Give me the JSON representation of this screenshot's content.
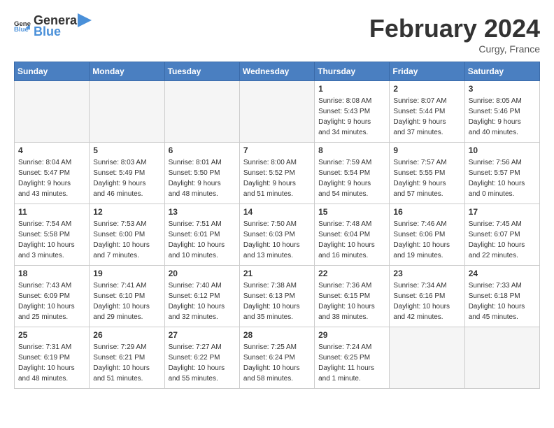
{
  "header": {
    "logo_general": "General",
    "logo_blue": "Blue",
    "month_year": "February 2024",
    "location": "Curgy, France"
  },
  "days_of_week": [
    "Sunday",
    "Monday",
    "Tuesday",
    "Wednesday",
    "Thursday",
    "Friday",
    "Saturday"
  ],
  "weeks": [
    [
      {
        "day": "",
        "info": ""
      },
      {
        "day": "",
        "info": ""
      },
      {
        "day": "",
        "info": ""
      },
      {
        "day": "",
        "info": ""
      },
      {
        "day": "1",
        "info": "Sunrise: 8:08 AM\nSunset: 5:43 PM\nDaylight: 9 hours\nand 34 minutes."
      },
      {
        "day": "2",
        "info": "Sunrise: 8:07 AM\nSunset: 5:44 PM\nDaylight: 9 hours\nand 37 minutes."
      },
      {
        "day": "3",
        "info": "Sunrise: 8:05 AM\nSunset: 5:46 PM\nDaylight: 9 hours\nand 40 minutes."
      }
    ],
    [
      {
        "day": "4",
        "info": "Sunrise: 8:04 AM\nSunset: 5:47 PM\nDaylight: 9 hours\nand 43 minutes."
      },
      {
        "day": "5",
        "info": "Sunrise: 8:03 AM\nSunset: 5:49 PM\nDaylight: 9 hours\nand 46 minutes."
      },
      {
        "day": "6",
        "info": "Sunrise: 8:01 AM\nSunset: 5:50 PM\nDaylight: 9 hours\nand 48 minutes."
      },
      {
        "day": "7",
        "info": "Sunrise: 8:00 AM\nSunset: 5:52 PM\nDaylight: 9 hours\nand 51 minutes."
      },
      {
        "day": "8",
        "info": "Sunrise: 7:59 AM\nSunset: 5:54 PM\nDaylight: 9 hours\nand 54 minutes."
      },
      {
        "day": "9",
        "info": "Sunrise: 7:57 AM\nSunset: 5:55 PM\nDaylight: 9 hours\nand 57 minutes."
      },
      {
        "day": "10",
        "info": "Sunrise: 7:56 AM\nSunset: 5:57 PM\nDaylight: 10 hours\nand 0 minutes."
      }
    ],
    [
      {
        "day": "11",
        "info": "Sunrise: 7:54 AM\nSunset: 5:58 PM\nDaylight: 10 hours\nand 3 minutes."
      },
      {
        "day": "12",
        "info": "Sunrise: 7:53 AM\nSunset: 6:00 PM\nDaylight: 10 hours\nand 7 minutes."
      },
      {
        "day": "13",
        "info": "Sunrise: 7:51 AM\nSunset: 6:01 PM\nDaylight: 10 hours\nand 10 minutes."
      },
      {
        "day": "14",
        "info": "Sunrise: 7:50 AM\nSunset: 6:03 PM\nDaylight: 10 hours\nand 13 minutes."
      },
      {
        "day": "15",
        "info": "Sunrise: 7:48 AM\nSunset: 6:04 PM\nDaylight: 10 hours\nand 16 minutes."
      },
      {
        "day": "16",
        "info": "Sunrise: 7:46 AM\nSunset: 6:06 PM\nDaylight: 10 hours\nand 19 minutes."
      },
      {
        "day": "17",
        "info": "Sunrise: 7:45 AM\nSunset: 6:07 PM\nDaylight: 10 hours\nand 22 minutes."
      }
    ],
    [
      {
        "day": "18",
        "info": "Sunrise: 7:43 AM\nSunset: 6:09 PM\nDaylight: 10 hours\nand 25 minutes."
      },
      {
        "day": "19",
        "info": "Sunrise: 7:41 AM\nSunset: 6:10 PM\nDaylight: 10 hours\nand 29 minutes."
      },
      {
        "day": "20",
        "info": "Sunrise: 7:40 AM\nSunset: 6:12 PM\nDaylight: 10 hours\nand 32 minutes."
      },
      {
        "day": "21",
        "info": "Sunrise: 7:38 AM\nSunset: 6:13 PM\nDaylight: 10 hours\nand 35 minutes."
      },
      {
        "day": "22",
        "info": "Sunrise: 7:36 AM\nSunset: 6:15 PM\nDaylight: 10 hours\nand 38 minutes."
      },
      {
        "day": "23",
        "info": "Sunrise: 7:34 AM\nSunset: 6:16 PM\nDaylight: 10 hours\nand 42 minutes."
      },
      {
        "day": "24",
        "info": "Sunrise: 7:33 AM\nSunset: 6:18 PM\nDaylight: 10 hours\nand 45 minutes."
      }
    ],
    [
      {
        "day": "25",
        "info": "Sunrise: 7:31 AM\nSunset: 6:19 PM\nDaylight: 10 hours\nand 48 minutes."
      },
      {
        "day": "26",
        "info": "Sunrise: 7:29 AM\nSunset: 6:21 PM\nDaylight: 10 hours\nand 51 minutes."
      },
      {
        "day": "27",
        "info": "Sunrise: 7:27 AM\nSunset: 6:22 PM\nDaylight: 10 hours\nand 55 minutes."
      },
      {
        "day": "28",
        "info": "Sunrise: 7:25 AM\nSunset: 6:24 PM\nDaylight: 10 hours\nand 58 minutes."
      },
      {
        "day": "29",
        "info": "Sunrise: 7:24 AM\nSunset: 6:25 PM\nDaylight: 11 hours\nand 1 minute."
      },
      {
        "day": "",
        "info": ""
      },
      {
        "day": "",
        "info": ""
      }
    ]
  ]
}
